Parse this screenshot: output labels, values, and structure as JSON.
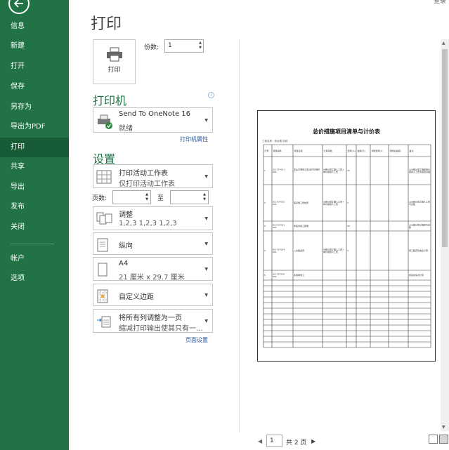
{
  "header": {
    "title": "打印",
    "signin": "登录"
  },
  "sidebar": {
    "items": [
      {
        "label": "信息"
      },
      {
        "label": "新建"
      },
      {
        "label": "打开"
      },
      {
        "label": "保存"
      },
      {
        "label": "另存为"
      },
      {
        "label": "导出为PDF"
      },
      {
        "label": "打印"
      },
      {
        "label": "共享"
      },
      {
        "label": "导出"
      },
      {
        "label": "发布"
      },
      {
        "label": "关闭"
      },
      {
        "label": "帐户"
      },
      {
        "label": "选项"
      }
    ],
    "active": "打印"
  },
  "print": {
    "button_label": "打印",
    "copies_label": "份数:",
    "copies_value": "1"
  },
  "printer": {
    "heading": "打印机",
    "name": "Send To OneNote 16",
    "status": "就绪",
    "properties_link": "打印机属性"
  },
  "settings": {
    "heading": "设置",
    "what": {
      "line1": "打印活动工作表",
      "line2": "仅打印活动工作表"
    },
    "pages_label": "页数:",
    "to_label": "至",
    "pages_from": "",
    "pages_to": "",
    "collate": {
      "line1": "调整",
      "line2": "1,2,3    1,2,3    1,2,3"
    },
    "orientation": {
      "line1": "纵向"
    },
    "paper": {
      "line1": "A4",
      "line2": "21 厘米 x 29.7 厘米"
    },
    "margins": {
      "line1": "自定义边距"
    },
    "scaling": {
      "line1": "将所有列调整为一页",
      "line2": "缩减打印输出使其只有一..."
    },
    "page_setup_link": "页面设置"
  },
  "preview": {
    "sheet_title": "总价措施项目清单与计价表",
    "meta": "工程名称：综合楼        标段：",
    "columns": [
      "序号",
      "项目编码",
      "项目名称",
      "计算基础",
      "费率(%)",
      "金额(元)",
      "调整费率(%)",
      "调整后金额(元)",
      "备注"
    ],
    "rows": [
      [
        "1",
        "011707001001",
        "安全文明施工费(含环境保护)",
        "分部分项工程人工费+单价措施人工费",
        "25",
        "",
        "",
        "",
        "以分部分项工程和单价措施人工费为取费基础"
      ],
      [
        "2",
        "011707002001",
        "夜间施工增加费",
        "分部分项工程人工费+单价措施人工费",
        "0",
        "",
        "",
        "",
        "以分部分项工程人工费为基数"
      ],
      [
        "3",
        "011707003001",
        "非夜间施工照明",
        "",
        "30",
        "",
        "",
        "",
        "以分部分项工程费为基数"
      ],
      [
        "4",
        "011707004001",
        "二次搬运费",
        "分部分项工程人工费+单价措施人工费",
        "0",
        "",
        "",
        "",
        "按工程实际发生计算"
      ],
      [
        "5",
        "011707005001",
        "冬雨季施工",
        "",
        "",
        "",
        "",
        "",
        "按实际情况计算"
      ]
    ]
  },
  "pager": {
    "current": "1",
    "total": "共 2 页"
  }
}
